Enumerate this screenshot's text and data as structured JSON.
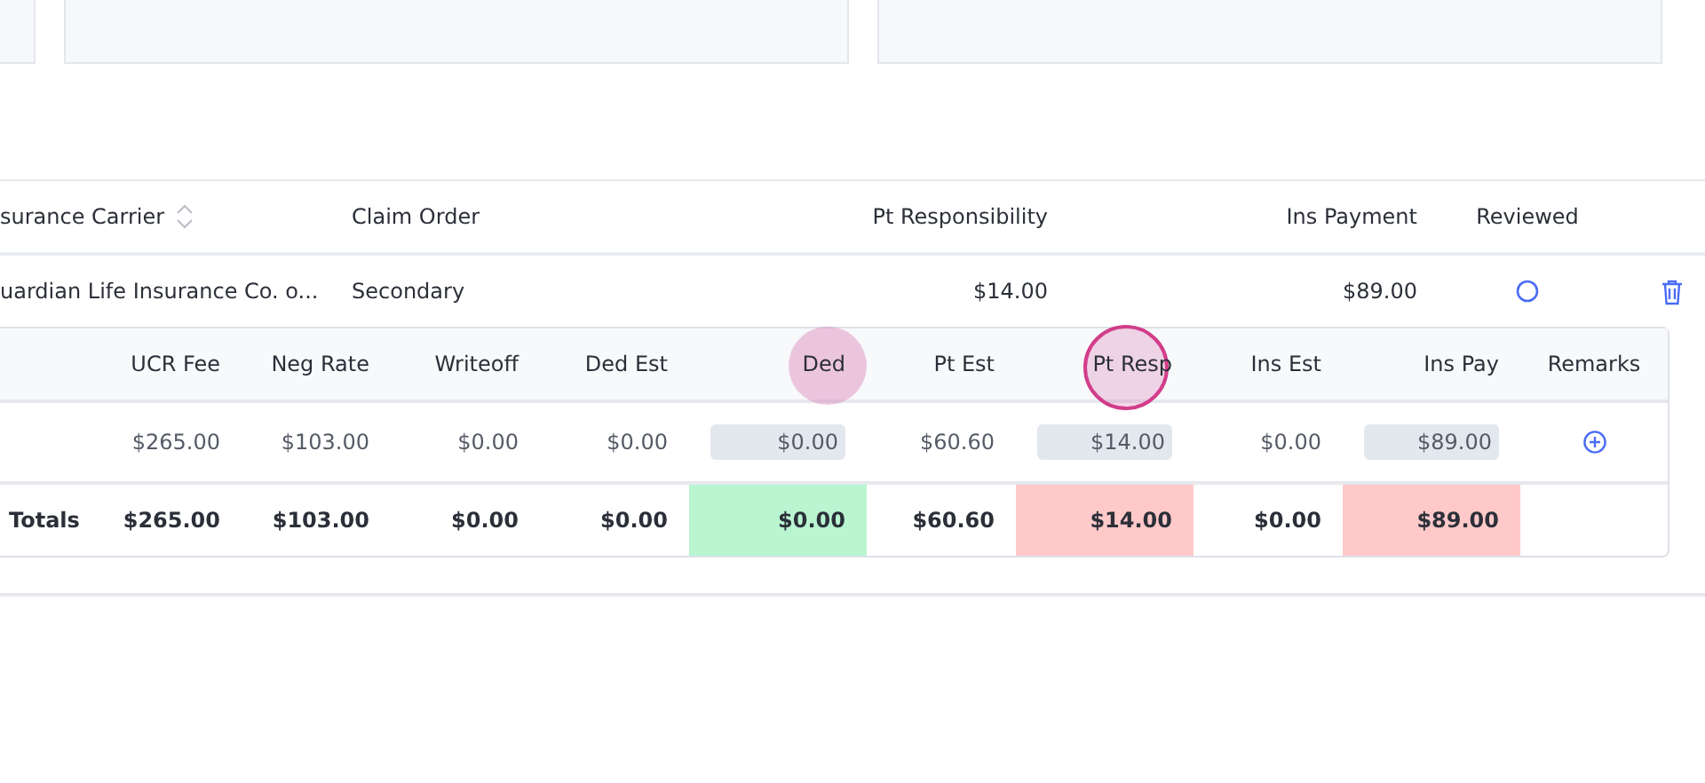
{
  "claims_table": {
    "columns": [
      {
        "label": "surance Carrier",
        "sortable": true
      },
      {
        "label": "Claim Order",
        "sortable": false
      },
      {
        "label": "Pt Responsibility",
        "sortable": false
      },
      {
        "label": "Ins Payment",
        "sortable": false
      },
      {
        "label": "Reviewed",
        "sortable": false
      }
    ],
    "rows": [
      {
        "carrier": "uardian Life Insurance Co. o...",
        "claim_order": "Secondary",
        "pt_responsibility": "$14.00",
        "ins_payment": "$89.00",
        "reviewed": false
      }
    ]
  },
  "procedure_table": {
    "columns": [
      {
        "label": "UCR Fee",
        "touched": false
      },
      {
        "label": "Neg Rate",
        "touched": false
      },
      {
        "label": "Writeoff",
        "touched": false
      },
      {
        "label": "Ded Est",
        "touched": false
      },
      {
        "label": "Ded",
        "touched": true,
        "touch_ring": false
      },
      {
        "label": "Pt Est",
        "touched": false
      },
      {
        "label": "Pt Resp",
        "touched": true,
        "touch_ring": true
      },
      {
        "label": "Ins Est",
        "touched": false
      },
      {
        "label": "Ins Pay",
        "touched": false
      },
      {
        "label": "Remarks",
        "touched": false
      }
    ],
    "rows": [
      [
        {
          "kind": "text",
          "text": "$265.00"
        },
        {
          "kind": "text",
          "text": "$103.00"
        },
        {
          "kind": "text",
          "text": "$0.00"
        },
        {
          "kind": "text",
          "text": "$0.00"
        },
        {
          "kind": "input",
          "text": "$0.00"
        },
        {
          "kind": "text",
          "text": "$60.60"
        },
        {
          "kind": "input",
          "text": "$14.00"
        },
        {
          "kind": "text",
          "text": "$0.00"
        },
        {
          "kind": "input",
          "text": "$89.00"
        },
        {
          "kind": "add"
        }
      ]
    ],
    "totals": [
      {
        "text": "Totals"
      },
      {
        "text": "$265.00"
      },
      {
        "text": "$103.00"
      },
      {
        "text": "$0.00"
      },
      {
        "text": "$0.00"
      },
      {
        "text": "$0.00",
        "color": "#b9f5d0"
      },
      {
        "text": "$60.60"
      },
      {
        "text": "$14.00",
        "color": "#ffc9c9"
      },
      {
        "text": "$0.00"
      },
      {
        "text": "$89.00",
        "color": "#ffc9c9"
      }
    ]
  }
}
